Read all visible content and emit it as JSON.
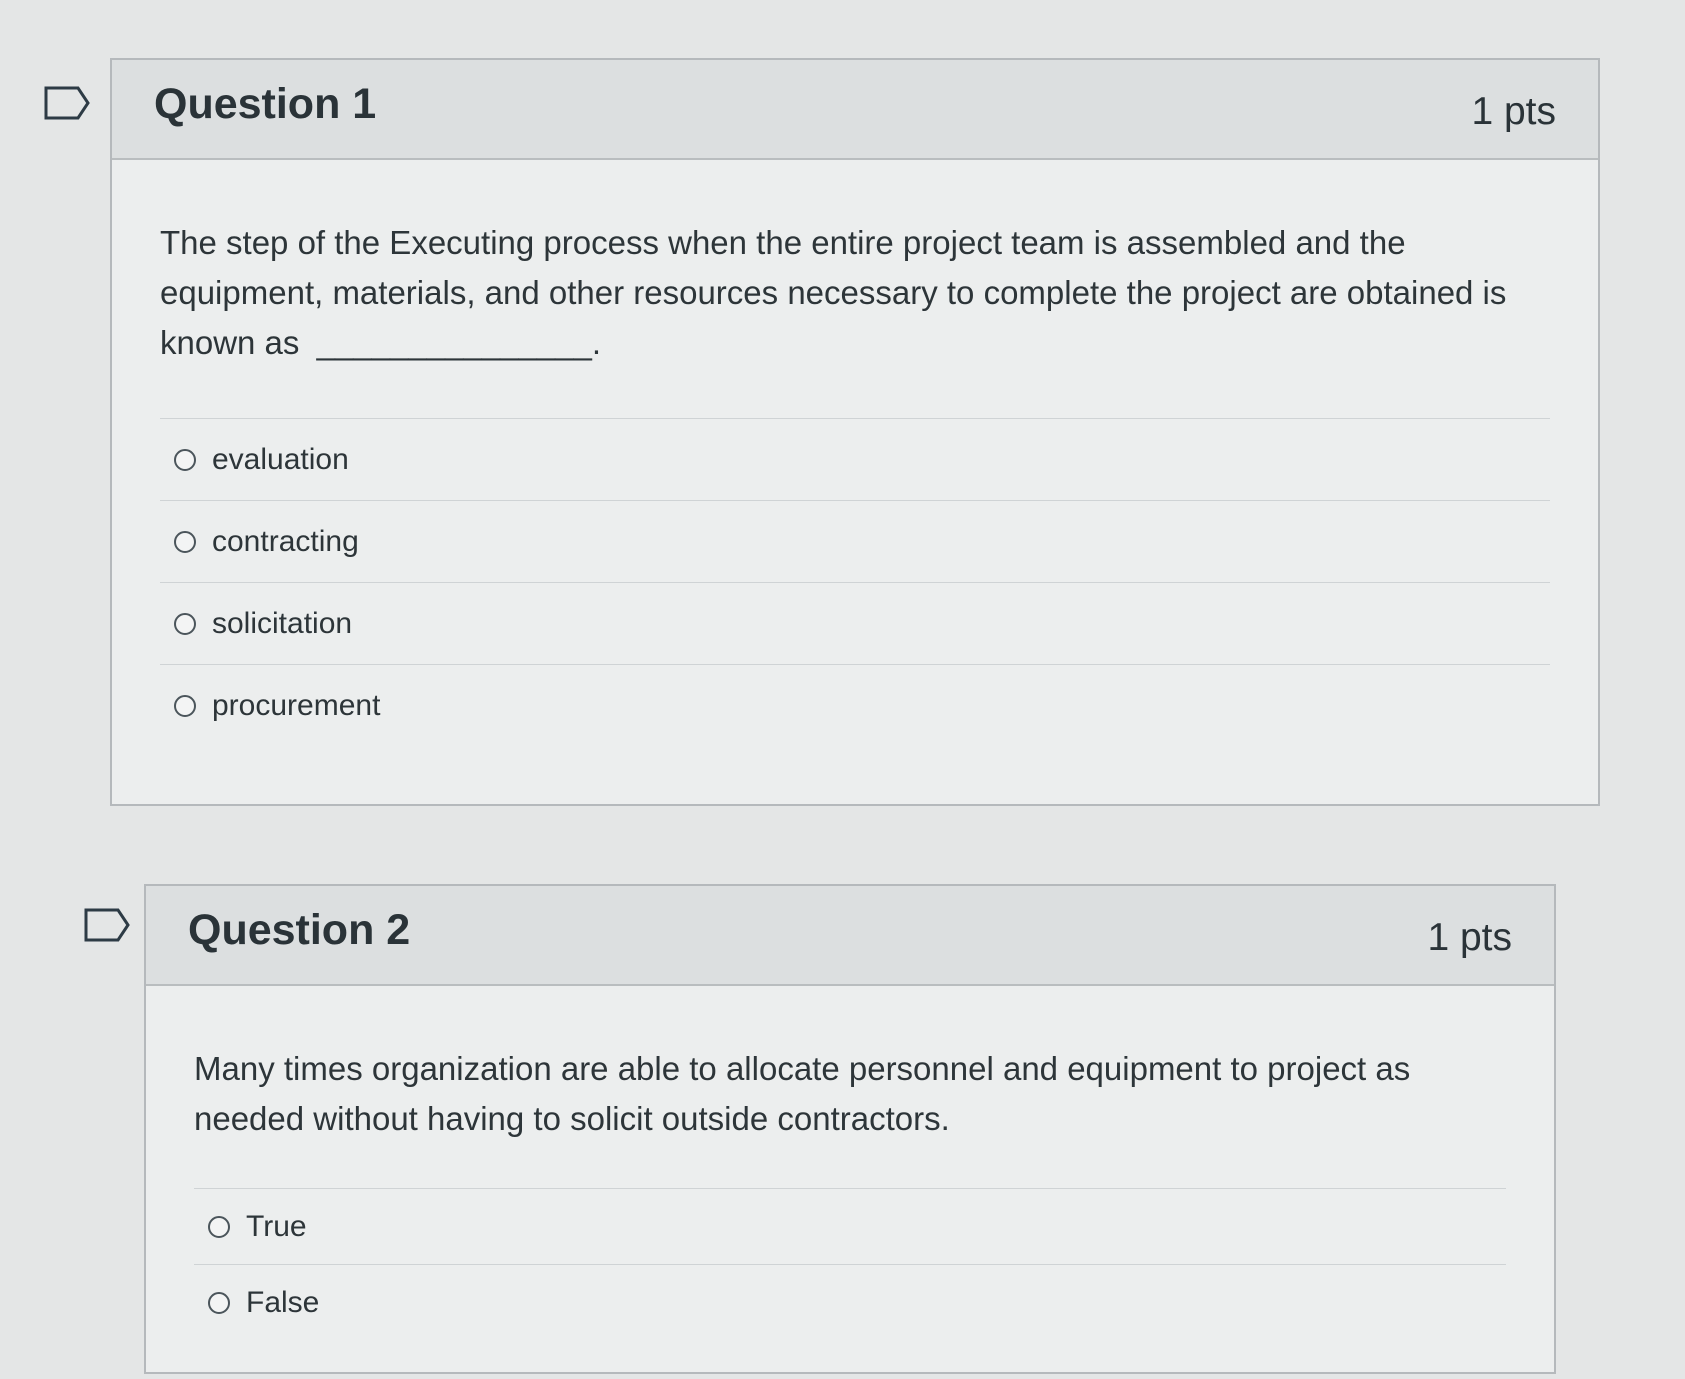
{
  "questions": [
    {
      "title": "Question 1",
      "points": "1 pts",
      "prompt": "The step of the Executing process when the entire project team is assembled and the equipment, materials, and other resources necessary to complete the project are obtained is known as",
      "blank": "_______________.",
      "answers": [
        "evaluation",
        "contracting",
        "solicitation",
        "procurement"
      ]
    },
    {
      "title": "Question 2",
      "points": "1 pts",
      "prompt": "Many times organization are able to allocate personnel and equipment to project as needed without having to solicit outside contractors.",
      "answers": [
        "True",
        "False"
      ]
    }
  ],
  "icons": {
    "flag": "flag-question-icon",
    "radio": "radio-button-icon"
  }
}
